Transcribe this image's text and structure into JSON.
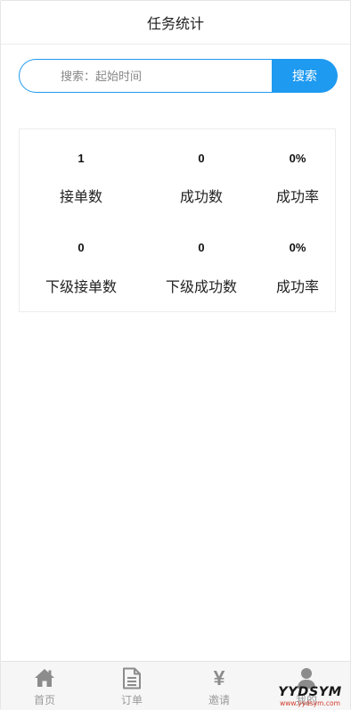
{
  "header": {
    "title": "任务统计"
  },
  "search": {
    "placeholder": "搜索：起始时间",
    "value": "",
    "button_label": "搜索"
  },
  "stats": {
    "row1": [
      {
        "value": "1",
        "label": "接单数"
      },
      {
        "value": "0",
        "label": "成功数"
      },
      {
        "value": "0%",
        "label": "成功率"
      }
    ],
    "row2": [
      {
        "value": "0",
        "label": "下级接单数"
      },
      {
        "value": "0",
        "label": "下级成功数"
      },
      {
        "value": "0%",
        "label": "成功率"
      }
    ]
  },
  "tabbar": {
    "items": [
      {
        "label": "首页",
        "icon": "home-icon"
      },
      {
        "label": "订单",
        "icon": "document-icon"
      },
      {
        "label": "邀请",
        "icon": "yen-icon"
      },
      {
        "label": "我的",
        "icon": "user-icon"
      }
    ]
  },
  "watermark": {
    "main": "YYDSYM",
    "sub": "www.yydsym.com"
  },
  "colors": {
    "accent": "#1e9af0",
    "tab_icon": "#8c8c8c",
    "tab_label": "#9a9a9a",
    "watermark_sub": "#d23a2a"
  }
}
